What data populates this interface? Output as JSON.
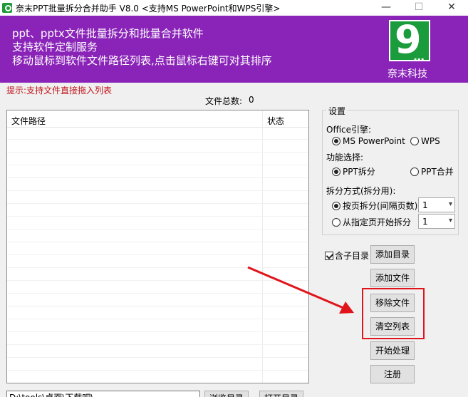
{
  "window": {
    "title": "奈末PPT批量拆分合并助手 V8.0  <支持MS PowerPoint和WPS引擎>",
    "min_glyph": "—",
    "max_glyph": "☐",
    "close_glyph": "✕"
  },
  "banner": {
    "line1": "ppt、pptx文件批量拆分和批量合并软件",
    "line2": "支持软件定制服务",
    "line3": "移动鼠标到软件文件路径列表,点击鼠标右键可对其排序",
    "logo_digit": "9",
    "logo_dots": "...",
    "logo_label": "奈末科技",
    "color": "#8a24b8",
    "logo_color": "#1a9b3c"
  },
  "hint": "提示:支持文件直接拖入列表",
  "file_count": {
    "label": "文件总数:",
    "value": "0"
  },
  "file_list": {
    "col_path": "文件路径",
    "col_status": "状态"
  },
  "settings": {
    "title": "设置",
    "engine_label": "Office引擎:",
    "engine_ms": "MS PowerPoint",
    "engine_wps": "WPS",
    "function_label": "功能选择:",
    "func_split": "PPT拆分",
    "func_merge": "PPT合并",
    "split_mode_label": "拆分方式(拆分用):",
    "mode_by_page": "按页拆分(间隔页数)",
    "mode_by_page_value": "1",
    "mode_from_page": "从指定页开始拆分",
    "mode_from_page_value": "1"
  },
  "subdir": {
    "label": "含子目录",
    "checked": true
  },
  "buttons": {
    "add_dir": "添加目录",
    "add_file": "添加文件",
    "remove_file": "移除文件",
    "clear_list": "清空列表",
    "start": "开始处理",
    "register": "注册",
    "browse": "浏览目录",
    "open_dir": "打开目录"
  },
  "output_path": "D:\\tools\\桌面\\下载吧\\",
  "annotation": {
    "color": "#e0141a"
  }
}
